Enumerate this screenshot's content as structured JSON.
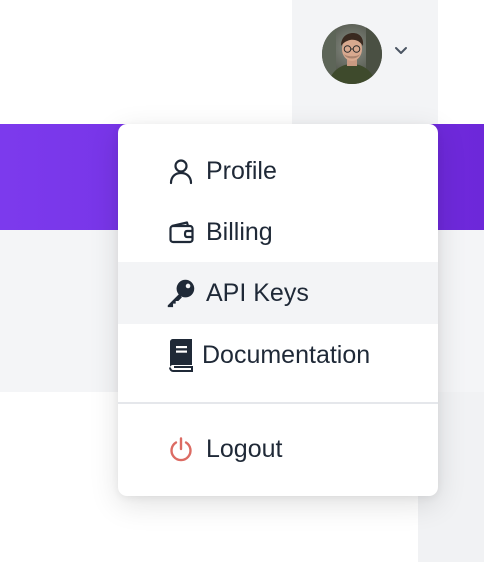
{
  "header": {
    "avatar_alt": "User avatar"
  },
  "menu": {
    "items": [
      {
        "label": "Profile",
        "icon": "user-icon",
        "active": false
      },
      {
        "label": "Billing",
        "icon": "wallet-icon",
        "active": false
      },
      {
        "label": "API Keys",
        "icon": "key-icon",
        "active": true
      },
      {
        "label": "Documentation",
        "icon": "book-icon",
        "active": false
      }
    ],
    "logout": {
      "label": "Logout",
      "icon": "power-icon"
    }
  },
  "colors": {
    "accent_purple": "#6d28d9",
    "logout_icon": "#dc6b63",
    "active_bg": "#f3f4f6",
    "text": "#1f2937"
  }
}
